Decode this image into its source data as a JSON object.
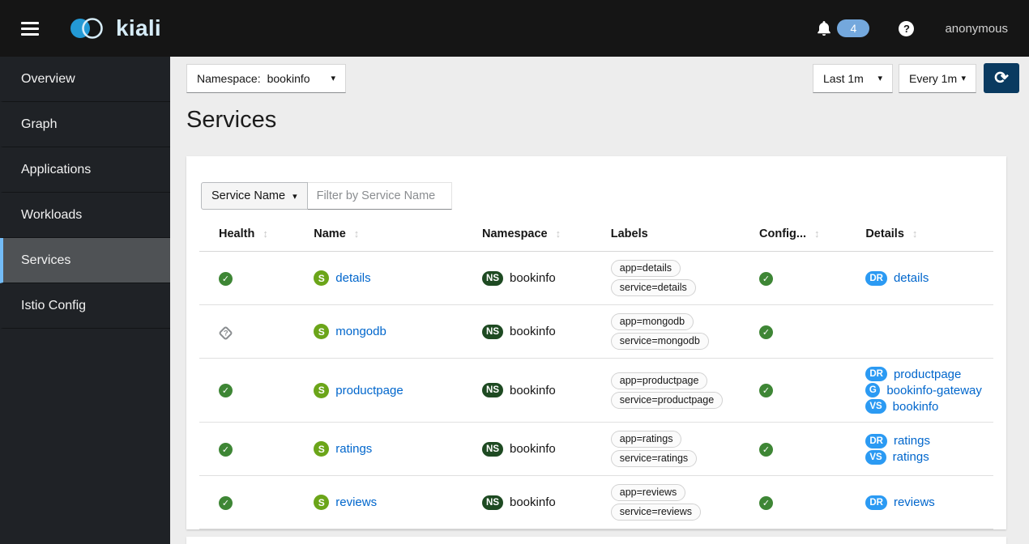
{
  "masthead": {
    "brand": "kiali",
    "notifications": "4",
    "username": "anonymous"
  },
  "sidebar": {
    "items": [
      {
        "label": "Overview",
        "active": false
      },
      {
        "label": "Graph",
        "active": false
      },
      {
        "label": "Applications",
        "active": false
      },
      {
        "label": "Workloads",
        "active": false
      },
      {
        "label": "Services",
        "active": true
      },
      {
        "label": "Istio Config",
        "active": false
      }
    ]
  },
  "toolbar": {
    "namespace_label": "Namespace:",
    "namespace_value": "bookinfo",
    "duration_value": "Last 1m",
    "refresh_interval_value": "Every 1m"
  },
  "page": {
    "title": "Services"
  },
  "filter": {
    "field_label": "Service Name",
    "placeholder": "Filter by Service Name"
  },
  "table": {
    "columns": [
      {
        "label": "Health",
        "sortable": true
      },
      {
        "label": "Name",
        "sortable": true
      },
      {
        "label": "Namespace",
        "sortable": true
      },
      {
        "label": "Labels",
        "sortable": false
      },
      {
        "label": "Config...",
        "sortable": true
      },
      {
        "label": "Details",
        "sortable": true
      }
    ],
    "badges": {
      "service": "S",
      "namespace": "NS"
    },
    "rows": [
      {
        "health": "healthy",
        "name": "details",
        "namespace": "bookinfo",
        "labels": [
          "app=details",
          "service=details"
        ],
        "config": "valid",
        "details": [
          {
            "badge": "DR",
            "text": "details"
          }
        ]
      },
      {
        "health": "unknown",
        "name": "mongodb",
        "namespace": "bookinfo",
        "labels": [
          "app=mongodb",
          "service=mongodb"
        ],
        "config": "valid",
        "details": []
      },
      {
        "health": "healthy",
        "name": "productpage",
        "namespace": "bookinfo",
        "labels": [
          "app=productpage",
          "service=productpage"
        ],
        "config": "valid",
        "details": [
          {
            "badge": "DR",
            "text": "productpage"
          },
          {
            "badge": "G",
            "text": "bookinfo-gateway"
          },
          {
            "badge": "VS",
            "text": "bookinfo"
          }
        ]
      },
      {
        "health": "healthy",
        "name": "ratings",
        "namespace": "bookinfo",
        "labels": [
          "app=ratings",
          "service=ratings"
        ],
        "config": "valid",
        "details": [
          {
            "badge": "DR",
            "text": "ratings"
          },
          {
            "badge": "VS",
            "text": "ratings"
          }
        ]
      },
      {
        "health": "healthy",
        "name": "reviews",
        "namespace": "bookinfo",
        "labels": [
          "app=reviews",
          "service=reviews"
        ],
        "config": "valid",
        "details": [
          {
            "badge": "DR",
            "text": "reviews"
          }
        ]
      }
    ]
  },
  "icons": {
    "caret": "▾",
    "sort": "↕",
    "refresh": "⟳",
    "check": "✓",
    "question": "?",
    "help": "?"
  },
  "colors": {
    "masthead_bg": "#151515",
    "sidebar_bg": "#1f2226",
    "nav_active_bg": "#4f5255",
    "nav_active_border": "#73bcf7",
    "notification_badge": "#74a8dd",
    "brand_blue": "#2399d5",
    "link_blue": "#0066cc",
    "refresh_button": "#0a3a60",
    "healthy_green": "#3e8635",
    "service_badge_green": "#6ba519",
    "namespace_badge_green": "#1e4a22",
    "istio_badge_blue": "#2b9af3"
  }
}
